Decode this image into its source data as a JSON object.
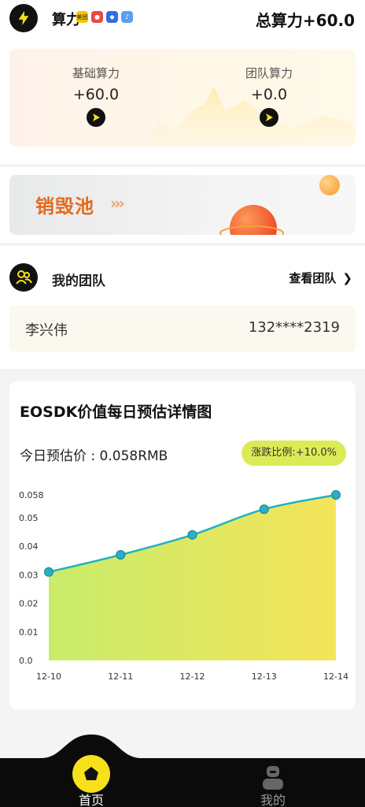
{
  "header": {
    "title": "算力",
    "notification_icons": [
      "meituan-icon",
      "weibo-icon",
      "app-store-icon",
      "music-icon"
    ],
    "meituan_label": "美团",
    "total_power": "总算力+60.0"
  },
  "power": {
    "basic_label": "基础算力",
    "basic_value": "+60.0",
    "team_label": "团队算力",
    "team_value": "+0.0"
  },
  "burn_pool": {
    "title": "销毁池",
    "arrows": "›››"
  },
  "team": {
    "title": "我的团队",
    "view_link": "查看团队",
    "view_arrow": "❯",
    "member_name": "李兴伟",
    "member_phone": "132****2319"
  },
  "chart_section": {
    "title": "EOSDK价值每日预估详情图",
    "price": "今日预估价 : 0.058RMB",
    "change": "涨跌比例:+10.0%"
  },
  "chart_data": {
    "type": "area",
    "x": [
      "12-10",
      "12-11",
      "12-12",
      "12-13",
      "12-14"
    ],
    "series": [
      {
        "values": [
          0.031,
          0.037,
          0.044,
          0.053,
          0.058
        ]
      }
    ],
    "y_ticks": [
      "0.0",
      "0.01",
      "0.02",
      "0.03",
      "0.04",
      "0.05",
      "0.058"
    ],
    "y_tick_values": [
      0,
      0.01,
      0.02,
      0.03,
      0.04,
      0.05,
      0.058
    ],
    "ylim": [
      0,
      0.058
    ],
    "grid": false,
    "colors": {
      "line": "#20b2c0",
      "point": "#28b0c8",
      "fill_start": "#c8ec6a",
      "fill_end": "#f4e45a"
    }
  },
  "nav": {
    "home_label": "首页",
    "mine_label": "我的"
  },
  "colors": {
    "accent_yellow": "#f6e11a",
    "burn_orange": "#e56a1c",
    "badge": "#dceb55"
  }
}
